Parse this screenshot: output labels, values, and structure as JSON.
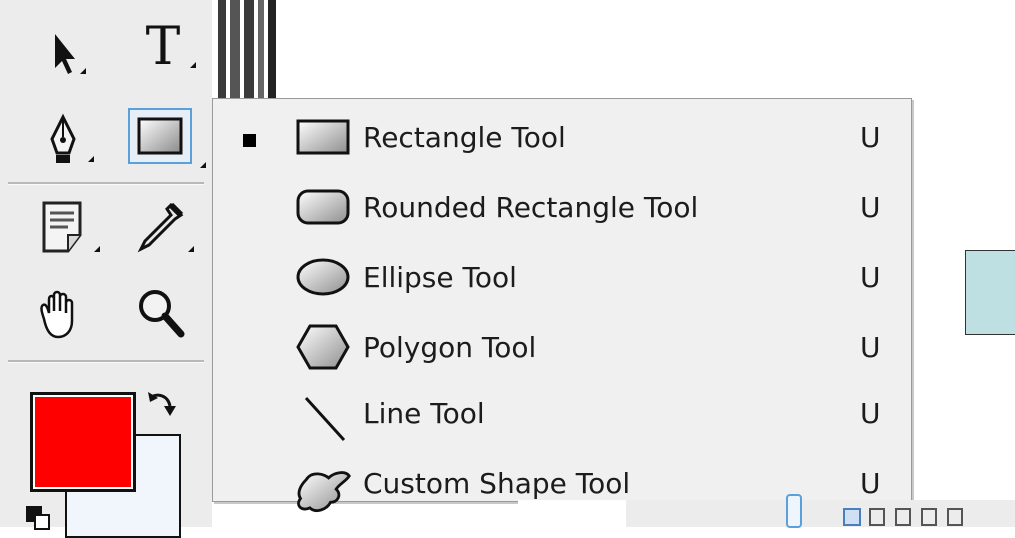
{
  "menu": {
    "items": [
      {
        "label": "Rectangle Tool",
        "shortcut": "U",
        "selected": true,
        "icon": "rectangle-icon"
      },
      {
        "label": "Rounded Rectangle Tool",
        "shortcut": "U",
        "selected": false,
        "icon": "rounded-rectangle-icon"
      },
      {
        "label": "Ellipse Tool",
        "shortcut": "U",
        "selected": false,
        "icon": "ellipse-icon"
      },
      {
        "label": "Polygon Tool",
        "shortcut": "U",
        "selected": false,
        "icon": "polygon-icon"
      },
      {
        "label": "Line Tool",
        "shortcut": "U",
        "selected": false,
        "icon": "line-icon"
      },
      {
        "label": "Custom Shape Tool",
        "shortcut": "U",
        "selected": false,
        "icon": "custom-shape-icon"
      }
    ]
  },
  "toolbox": {
    "type_tool_glyph": "T",
    "tools": [
      "selection-arrow-icon",
      "type-tool-icon",
      "pen-tool-icon",
      "rectangle-tool-icon",
      "notes-tool-icon",
      "eyedropper-icon",
      "hand-tool-icon",
      "zoom-tool-icon",
      "swap-colors-icon",
      "default-colors-icon"
    ],
    "foreground_color": "#ff0000",
    "background_color": "#f0f6fb"
  },
  "colors": {
    "swatch": "#bfe0e3",
    "selected_highlight": "#5aa0dc"
  }
}
